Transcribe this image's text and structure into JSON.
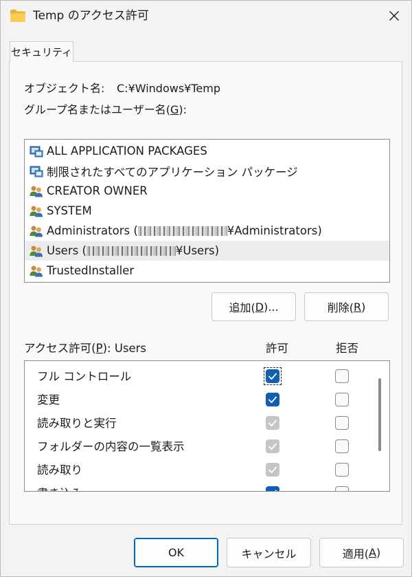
{
  "window": {
    "title": "Temp のアクセス許可",
    "close_glyph": "✕"
  },
  "tabs": [
    {
      "label": "セキュリティ"
    }
  ],
  "object": {
    "label": "オブジェクト名:",
    "value": "C:¥Windows¥Temp"
  },
  "group_label": {
    "text": "グループ名またはユーザー名(",
    "accel": "G",
    "suffix": "):"
  },
  "principals": [
    {
      "name": "ALL APPLICATION PACKAGES",
      "icon": "app-package-icon"
    },
    {
      "name": "制限されたすべてのアプリケーション パッケージ",
      "icon": "app-package-icon"
    },
    {
      "name": "CREATOR OWNER",
      "icon": "users-group-icon"
    },
    {
      "name": "SYSTEM",
      "icon": "users-group-icon"
    },
    {
      "name_prefix": "Administrators (",
      "name_suffix": "¥Administrators)",
      "icon": "users-group-icon",
      "redacted": true
    },
    {
      "name_prefix": "Users (",
      "name_suffix": "¥Users)",
      "icon": "users-group-icon",
      "redacted": true,
      "selected": true
    },
    {
      "name": "TrustedInstaller",
      "icon": "users-group-icon"
    }
  ],
  "buttons": {
    "add": {
      "text": "追加(",
      "accel": "D",
      "suffix": ")..."
    },
    "remove": {
      "text": "削除(",
      "accel": "R",
      "suffix": ")"
    },
    "ok": "OK",
    "cancel": "キャンセル",
    "apply": {
      "text": "適用(",
      "accel": "A",
      "suffix": ")"
    }
  },
  "permissions": {
    "header_text": "アクセス許可(",
    "header_accel": "P",
    "header_suffix": "): Users",
    "allow_label": "許可",
    "deny_label": "拒否",
    "rows": [
      {
        "name": "フル コントロール",
        "allow": "checked",
        "deny": "unchecked",
        "focused": true
      },
      {
        "name": "変更",
        "allow": "checked",
        "deny": "unchecked"
      },
      {
        "name": "読み取りと実行",
        "allow": "inherited",
        "deny": "unchecked"
      },
      {
        "name": "フォルダーの内容の一覧表示",
        "allow": "inherited",
        "deny": "unchecked"
      },
      {
        "name": "読み取り",
        "allow": "inherited",
        "deny": "unchecked"
      },
      {
        "name": "書き込み",
        "allow": "checked",
        "deny": "unchecked"
      }
    ]
  },
  "colors": {
    "accent": "#0f5fb4",
    "inherited_check": "#c5c5c5",
    "selection": "#ececec"
  }
}
